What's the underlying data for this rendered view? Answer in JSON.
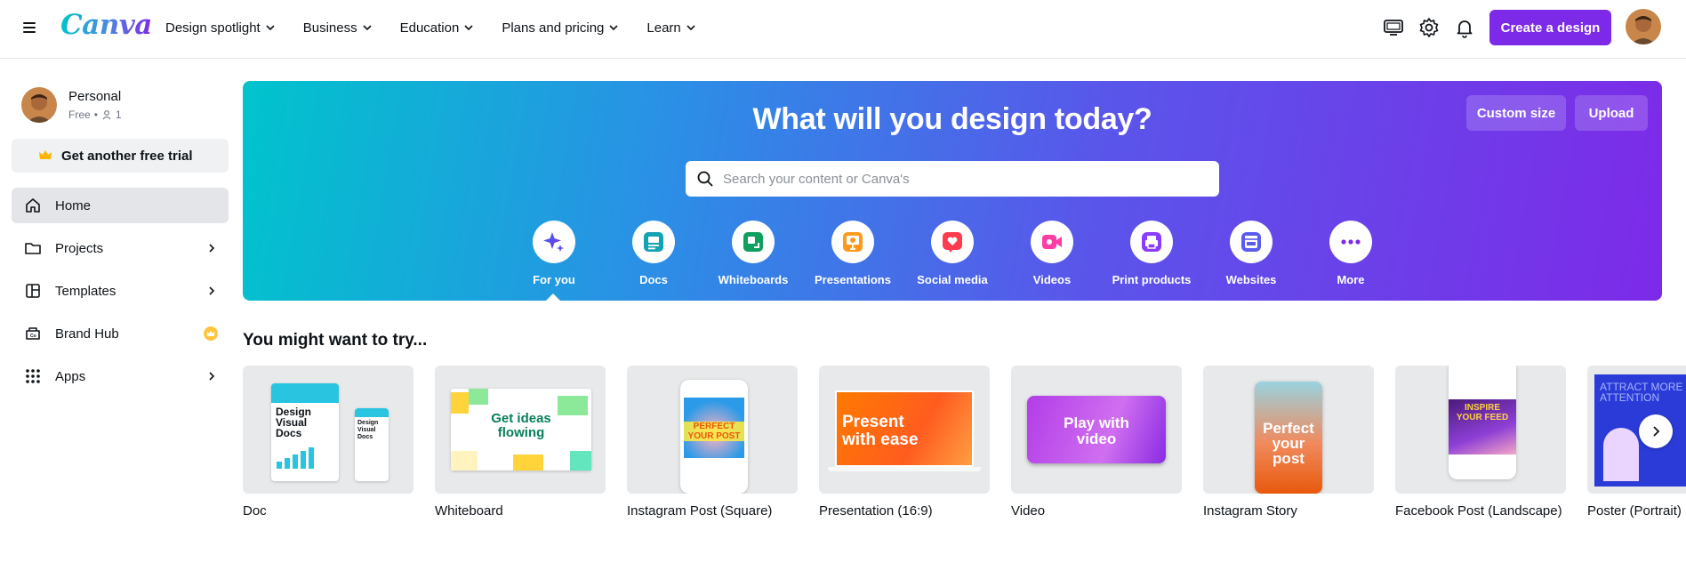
{
  "topbar": {
    "logo": "Canva",
    "nav": [
      "Design spotlight",
      "Business",
      "Education",
      "Plans and pricing",
      "Learn"
    ],
    "create_label": "Create a design"
  },
  "sidebar": {
    "account_name": "Personal",
    "plan": "Free",
    "members": "1",
    "trial_label": "Get another free trial",
    "items": [
      {
        "label": "Home"
      },
      {
        "label": "Projects"
      },
      {
        "label": "Templates"
      },
      {
        "label": "Brand Hub"
      },
      {
        "label": "Apps"
      }
    ]
  },
  "hero": {
    "title": "What will you design today?",
    "custom_size_label": "Custom size",
    "upload_label": "Upload",
    "search_placeholder": "Search your content or Canva's",
    "categories": [
      "For you",
      "Docs",
      "Whiteboards",
      "Presentations",
      "Social media",
      "Videos",
      "Print products",
      "Websites",
      "More"
    ]
  },
  "suggestions": {
    "title": "You might want to try...",
    "cards": [
      "Doc",
      "Whiteboard",
      "Instagram Post (Square)",
      "Presentation (16:9)",
      "Video",
      "Instagram Story",
      "Facebook Post (Landscape)",
      "Poster (Portrait)"
    ],
    "thumb_text": {
      "doc": "Design Visual Docs",
      "doc_small": "Design Visual Docs",
      "whiteboard": "Get ideas flowing",
      "insta_post": "PERFECT YOUR POST",
      "presentation": "Present with ease",
      "video": "Play with video",
      "story": "Perfect your post",
      "facebook": "INSPIRE YOUR FEED",
      "poster": "ATTRACT MORE ATTENTION"
    }
  },
  "colors": {
    "brand_purple": "#7d2ae8",
    "brand_teal": "#00c4cc"
  }
}
